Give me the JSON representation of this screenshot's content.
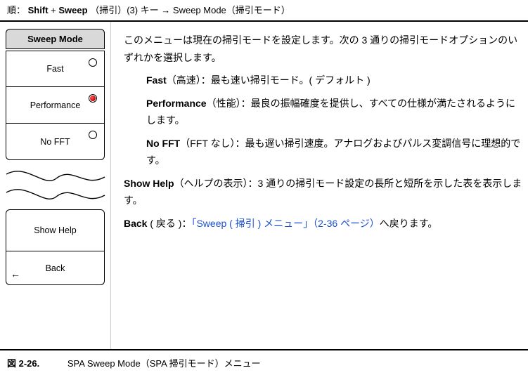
{
  "crumb": {
    "prefix_partial": "順：",
    "shift": "Shift",
    "sep1": " + ",
    "sweep_btn": "Sweep",
    "sweep_btn_jp": "（掃引）(3) キー → Sweep Mode（掃引モード）"
  },
  "menu": {
    "header": "Sweep Mode",
    "items": [
      {
        "label": "Fast",
        "selected": false
      },
      {
        "label": "Performance",
        "selected": true
      },
      {
        "label": "No FFT",
        "selected": false
      }
    ],
    "bottom": [
      {
        "label": "Show Help"
      },
      {
        "label": "Back"
      }
    ],
    "back_arrow": "←"
  },
  "desc": {
    "intro": "このメニューは現在の掃引モードを設定します。次の 3 通りの掃引モードオプションのいずれかを選択します。",
    "fast_term": "Fast",
    "fast_jp": "（高速）：最も速い掃引モード。( デフォルト )",
    "perf_term": "Performance",
    "perf_jp": "（性能）：最良の振幅確度を提供し、すべての仕様が満たされるようにします。",
    "nofft_term": "No FFT",
    "nofft_jp": "（FFT なし）：最も遅い掃引速度。アナログおよびパルス変調信号に理想的です。",
    "help_term": "Show Help",
    "help_jp": "（ヘルプの表示）：3 通りの掃引モード設定の長所と短所を示した表を表示します。",
    "back_term": "Back",
    "back_jp_pre": " ( 戻る )：",
    "back_link": "「Sweep ( 掃引 ) メニュー」（2-36 ページ）",
    "back_jp_post": "へ戻ります。"
  },
  "caption": {
    "fig": "図  2-26.",
    "text": "SPA Sweep Mode（SPA 掃引モード）メニュー"
  }
}
